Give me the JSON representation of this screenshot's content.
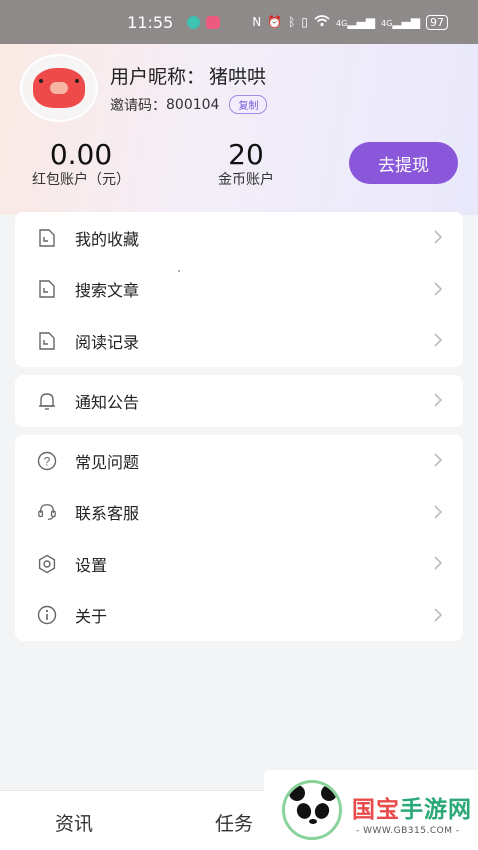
{
  "status_bar": {
    "time": "11:55",
    "network_label": "4G",
    "battery": "97"
  },
  "profile": {
    "nickname_label": "用户昵称：",
    "nickname": "猪哄哄",
    "invite_label": "邀请码：",
    "invite_code": "800104",
    "copy_label": "复制",
    "avatar_icon": "pig-avatar-icon"
  },
  "wallet": {
    "redpack_value": "0.00",
    "redpack_label": "红包账户（元）",
    "coins_value": "20",
    "coins_label": "金币账户",
    "withdraw_label": "去提现"
  },
  "menu_group_1": [
    {
      "label": "我的收藏",
      "icon": "document-icon"
    },
    {
      "label": "搜索文章",
      "icon": "document-icon"
    },
    {
      "label": "阅读记录",
      "icon": "document-icon"
    }
  ],
  "menu_group_2": [
    {
      "label": "通知公告",
      "icon": "bell-icon"
    }
  ],
  "menu_group_3": [
    {
      "label": "常见问题",
      "icon": "question-icon"
    },
    {
      "label": "联系客服",
      "icon": "headset-icon"
    },
    {
      "label": "设置",
      "icon": "gear-icon"
    },
    {
      "label": "关于",
      "icon": "info-icon"
    }
  ],
  "bottom_nav": {
    "items": [
      "资讯",
      "任务"
    ]
  },
  "watermark": {
    "brand_first": "国宝",
    "brand_rest": "手游网",
    "url": "- WWW.GB315.COM -"
  },
  "colors": {
    "accent": "#8a57db",
    "watermark_green": "#2aa876"
  }
}
